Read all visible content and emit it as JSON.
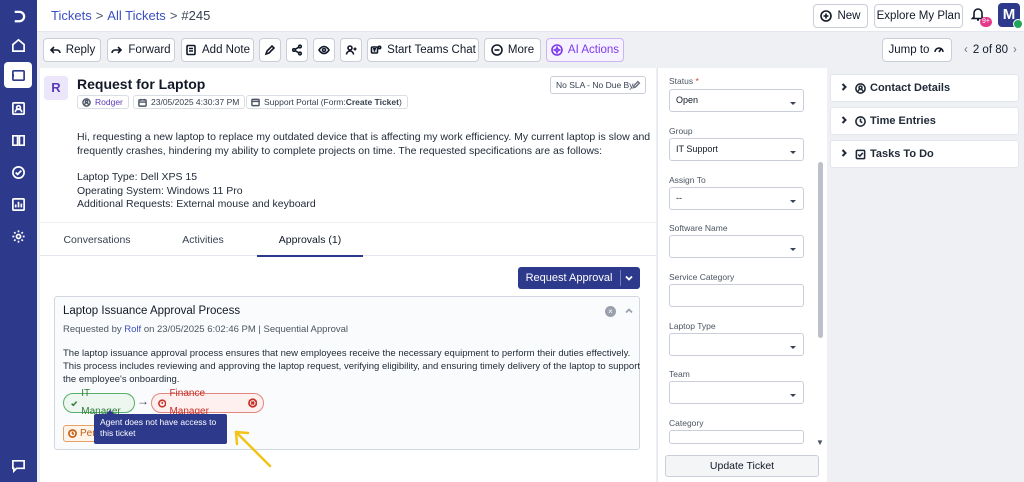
{
  "breadcrumb": {
    "root": "Tickets",
    "list": "All Tickets",
    "current": "#245",
    "sep": ">"
  },
  "topbar": {
    "new_label": "New",
    "plan_label": "Explore My Plan",
    "notif_count": "9+",
    "user_initial": "M"
  },
  "actions": {
    "reply": "Reply",
    "forward": "Forward",
    "add_note": "Add Note",
    "teams_chat": "Start Teams Chat",
    "more": "More",
    "ai_actions": "AI Actions",
    "jump_to": "Jump to",
    "position": "2 of 80"
  },
  "ticket": {
    "type_initial": "R",
    "title": "Request for Laptop",
    "requester": "Rodger",
    "created": "23/05/2025 4:30:37 PM",
    "source_prefix": "Support Portal (Form: ",
    "source_form": "Create Ticket",
    "source_suffix": ")",
    "sla": "No SLA - No Due By",
    "description": [
      "Hi, requesting a new laptop to replace my outdated device that is affecting my work efficiency. My current laptop is slow and",
      "frequently crashes, hindering my ability to complete projects on time. The requested specifications are as follows:",
      "Laptop Type: Dell XPS 15",
      "Operating System: Windows 11 Pro",
      "Additional Requests: External mouse and keyboard"
    ]
  },
  "tabs": {
    "conversations": "Conversations",
    "activities": "Activities",
    "approvals": "Approvals (1)"
  },
  "approval": {
    "request_button": "Request Approval",
    "title": "Laptop Issuance Approval Process",
    "requested_by_prefix": "Requested by",
    "requested_by_name": "Rolf",
    "requested_on": "on 23/05/2025 6:02:46 PM | Sequential Approval",
    "text": [
      "The laptop issuance approval process ensures that new employees receive the necessary equipment to perform their duties effectively.",
      "This process includes reviewing and approving the laptop request, verifying eligibility, and ensuring timely delivery of the laptop to support",
      "the employee's onboarding."
    ],
    "approver_1": "IT Manager",
    "approver_2": "Finance Manager",
    "flow_arrow": "→",
    "pending_label": "Pen",
    "tooltip": "Agent does not have access to this ticket"
  },
  "properties": {
    "status_label": "Status",
    "status_required": "*",
    "status_value": "Open",
    "group_label": "Group",
    "group_value": "IT Support",
    "assign_label": "Assign To",
    "assign_value": "--",
    "software_label": "Software Name",
    "software_value": "",
    "service_category_label": "Service Category",
    "service_category_value": "",
    "laptop_type_label": "Laptop Type",
    "laptop_type_value": "",
    "team_label": "Team",
    "team_value": "",
    "category_label": "Category",
    "category_value": "",
    "update_button": "Update Ticket"
  },
  "widgets": {
    "contact": "Contact Details",
    "time": "Time Entries",
    "todo": "Tasks To Do"
  },
  "colors": {
    "brand": "#2d3a8c",
    "ai": "#7c3aed",
    "approved": "#2f7d3d",
    "rejected": "#c62f25",
    "pending": "#c25d11",
    "pointer": "#f2c318"
  }
}
